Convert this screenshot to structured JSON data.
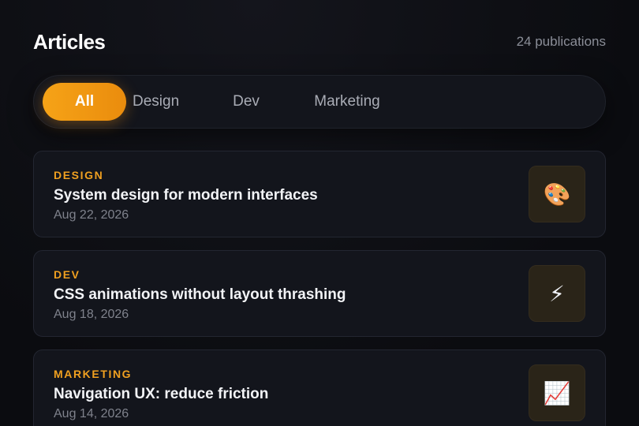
{
  "header": {
    "title": "Articles",
    "count": "24 publications"
  },
  "tabs": [
    {
      "label": "All",
      "active": true
    },
    {
      "label": "Design",
      "active": false
    },
    {
      "label": "Dev",
      "active": false
    },
    {
      "label": "Marketing",
      "active": false
    }
  ],
  "colors": {
    "accent": "#f6a317",
    "background": "#0b0c10",
    "card": "#13151c"
  },
  "articles": [
    {
      "category": "Design",
      "title": "System design for modern interfaces",
      "date": "Aug 22, 2026",
      "icon": "palette-icon",
      "glyph": "🎨"
    },
    {
      "category": "Dev",
      "title": "CSS animations without layout thrashing",
      "date": "Aug 18, 2026",
      "icon": "lightning-icon",
      "glyph": "⚡"
    },
    {
      "category": "Marketing",
      "title": "Navigation UX: reduce friction",
      "date": "Aug 14, 2026",
      "icon": "chart-increasing-icon",
      "glyph": "📈"
    }
  ]
}
